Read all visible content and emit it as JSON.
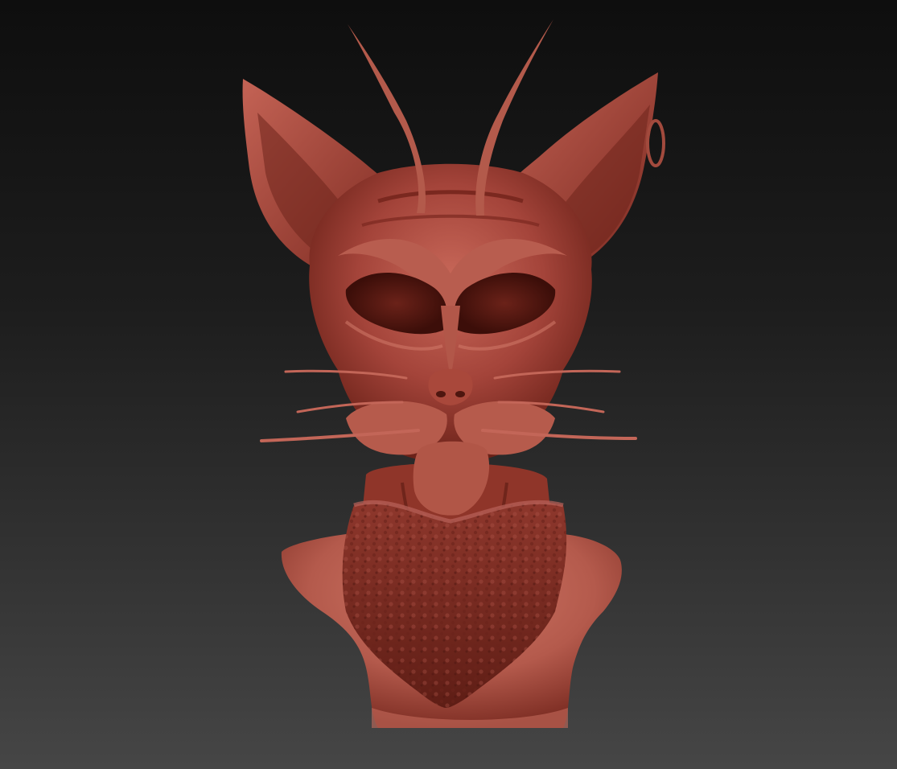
{
  "scene": {
    "subject": "sculpted-cat-bust",
    "colors": {
      "background_top": "#0e0e0e",
      "background_bottom": "#464646",
      "clay_light": "#d27a6a",
      "clay_mid": "#a7473a",
      "clay_dark": "#5a1a12",
      "clay_shadow": "#3c0e09"
    }
  }
}
